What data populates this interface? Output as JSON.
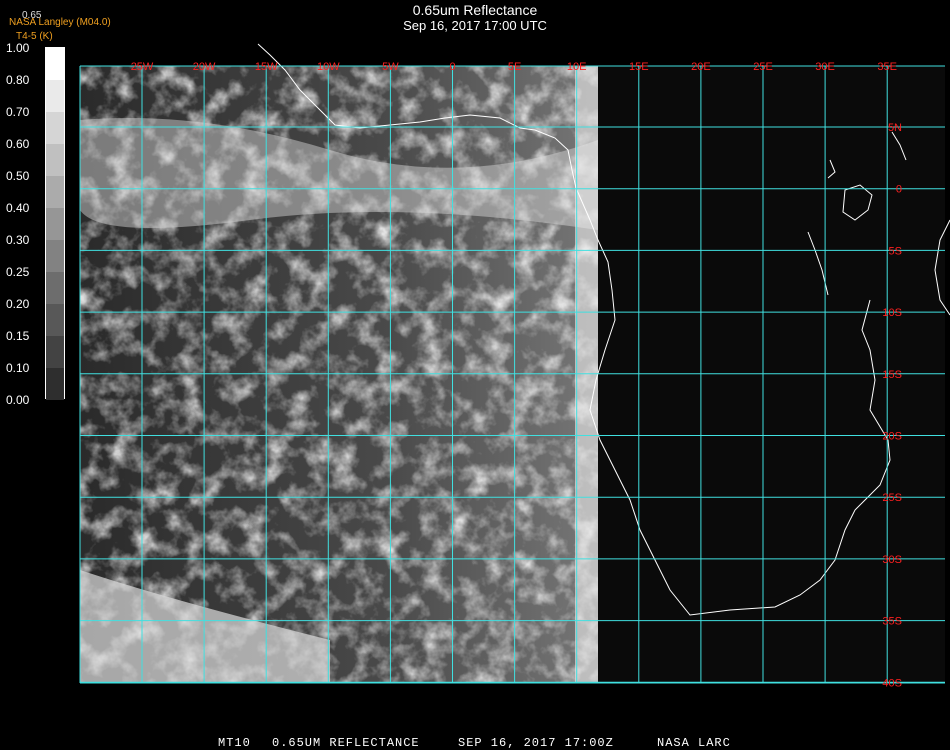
{
  "header": {
    "title": "0.65um Reflectance",
    "subtitle": "Sep 16, 2017 17:00 UTC",
    "brand": "NASA Langley (M04.0)",
    "sub_units": "T4-5 (K)",
    "mini_label": "0.65"
  },
  "scale": {
    "labels": [
      "1.00",
      "0.80",
      "0.70",
      "0.60",
      "0.50",
      "0.40",
      "0.30",
      "0.25",
      "0.20",
      "0.15",
      "0.10",
      "0.00"
    ]
  },
  "map": {
    "lon_labels": [
      "25W",
      "20W",
      "15W",
      "10W",
      "5W",
      "0",
      "5E",
      "10E",
      "15E",
      "20E",
      "25E",
      "30E",
      "35E"
    ],
    "lat_labels": [
      "5N",
      "0",
      "5S",
      "10S",
      "15S",
      "20S",
      "25S",
      "30S",
      "35S",
      "40S"
    ],
    "grid_color": "#40e0e0",
    "label_color": "#ff2020"
  },
  "footer": {
    "sat": "MT10",
    "product": "0.65UM REFLECTANCE",
    "datetime": "SEP 16, 2017 17:00Z",
    "source": "NASA LARC"
  }
}
